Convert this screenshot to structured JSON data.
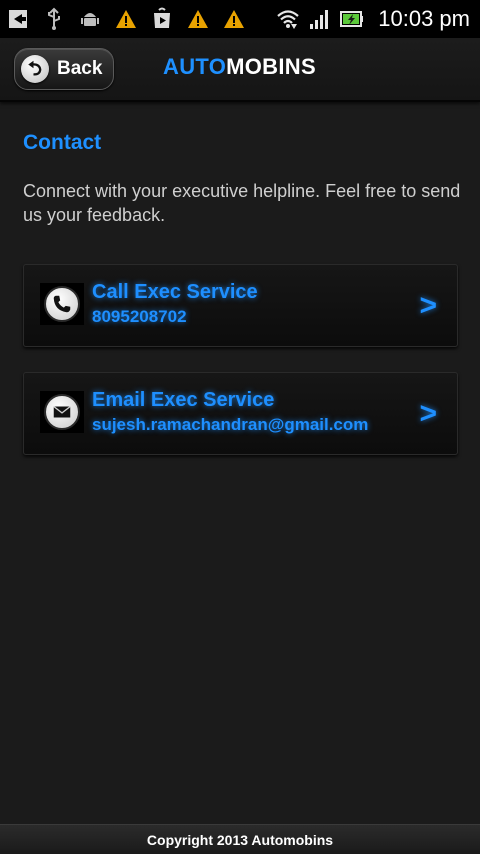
{
  "status_bar": {
    "time": "10:03 pm",
    "left_icons": [
      "notification-arrow-icon",
      "usb-icon",
      "android-debug-icon",
      "warning-icon",
      "play-store-icon",
      "warning-icon",
      "warning-icon"
    ],
    "right_icons": [
      "wifi-icon",
      "signal-icon",
      "battery-charging-icon"
    ]
  },
  "header": {
    "back_label": "Back",
    "title_part1": "AUTO",
    "title_part2": "MOBINS",
    "accent_color": "#1e90ff"
  },
  "content": {
    "title": "Contact",
    "description": "Connect with your executive helpline. Feel free to send us your feedback."
  },
  "cards": [
    {
      "icon": "phone-icon",
      "title": "Call Exec Service",
      "subtitle": "8095208702",
      "arrow": ">"
    },
    {
      "icon": "mail-icon",
      "title": "Email Exec Service",
      "subtitle": "sujesh.ramachandran@gmail.com",
      "arrow": ">"
    }
  ],
  "footer": {
    "text": "Copyright 2013 Automobins"
  }
}
